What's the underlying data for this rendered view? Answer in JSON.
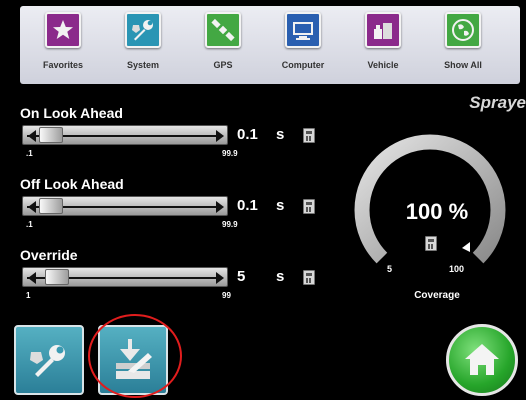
{
  "toolbar": {
    "items": [
      {
        "label": "Favorites",
        "icon": "star-icon",
        "color": "#8b2a8b"
      },
      {
        "label": "System",
        "icon": "wrench-icon",
        "color": "#2a95b4"
      },
      {
        "label": "GPS",
        "icon": "satellite-icon",
        "color": "#43a843"
      },
      {
        "label": "Computer",
        "icon": "computer-icon",
        "color": "#2a5fb0"
      },
      {
        "label": "Vehicle",
        "icon": "vehicle-icon",
        "color": "#8b2a8b"
      },
      {
        "label": "Show All",
        "icon": "globe-icon",
        "color": "#43a843"
      }
    ]
  },
  "page": {
    "title": "Spraye"
  },
  "sliders": [
    {
      "label": "On Look Ahead",
      "value": "0.1",
      "unit": "s",
      "min": ".1",
      "max": "99.9",
      "level": 0.01
    },
    {
      "label": "Off Look Ahead",
      "value": "0.1",
      "unit": "s",
      "min": ".1",
      "max": "99.9",
      "level": 0.01
    },
    {
      "label": "Override",
      "value": "5",
      "unit": "s",
      "min": "1",
      "max": "99",
      "level": 0.05
    }
  ],
  "gauge": {
    "value": "100 %",
    "min": "5",
    "max": "100",
    "label": "Coverage",
    "level": 1.0
  },
  "bottom_buttons": [
    {
      "icon": "wrench-icon"
    },
    {
      "icon": "sprayer-section-icon"
    }
  ],
  "home": {
    "icon": "home-icon"
  },
  "colors": {
    "background": "#000000",
    "toolbar": "#dcdde5",
    "button_teal": "#3c9bb2",
    "home_green": "#2fae33",
    "highlight_red": "#e11d1d"
  }
}
